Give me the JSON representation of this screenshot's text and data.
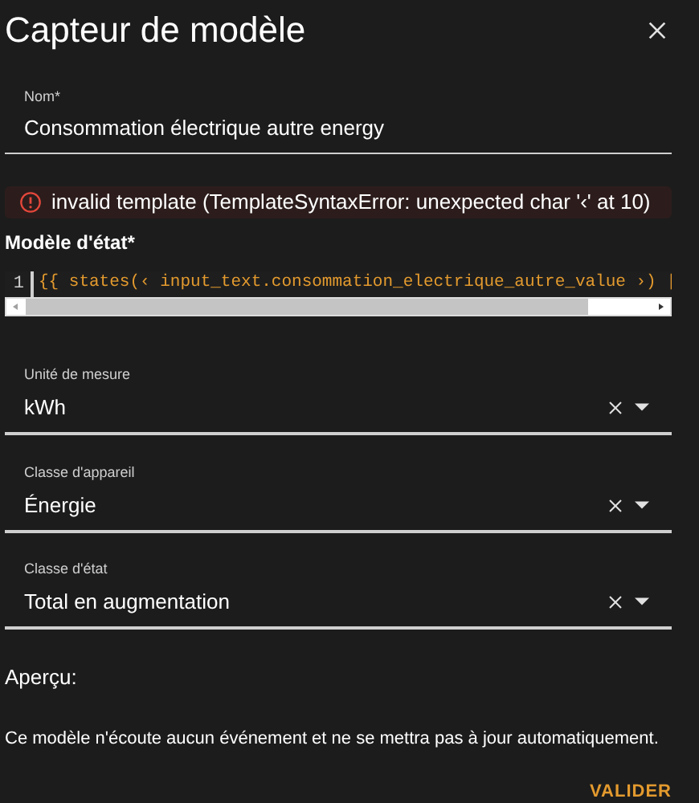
{
  "dialog": {
    "title": "Capteur de modèle"
  },
  "name_field": {
    "label": "Nom*",
    "value": "Consommation électrique autre energy"
  },
  "error": {
    "message": "invalid template (TemplateSyntaxError: unexpected char '‹' at 10)"
  },
  "template": {
    "label": "Modèle d'état*",
    "line_number": "1",
    "code": "{{ states(‹ input_text.consommation_electrique_autre_value ›) |"
  },
  "selects": [
    {
      "label": "Unité de mesure",
      "value": "kWh"
    },
    {
      "label": "Classe d'appareil",
      "value": "Énergie"
    },
    {
      "label": "Classe d'état",
      "value": "Total en augmentation"
    }
  ],
  "preview": {
    "heading": "Aperçu:",
    "message": "Ce modèle n'écoute aucun événement et ne se mettra pas à jour automatiquement."
  },
  "buttons": [
    {
      "label": "VALIDER"
    }
  ]
}
